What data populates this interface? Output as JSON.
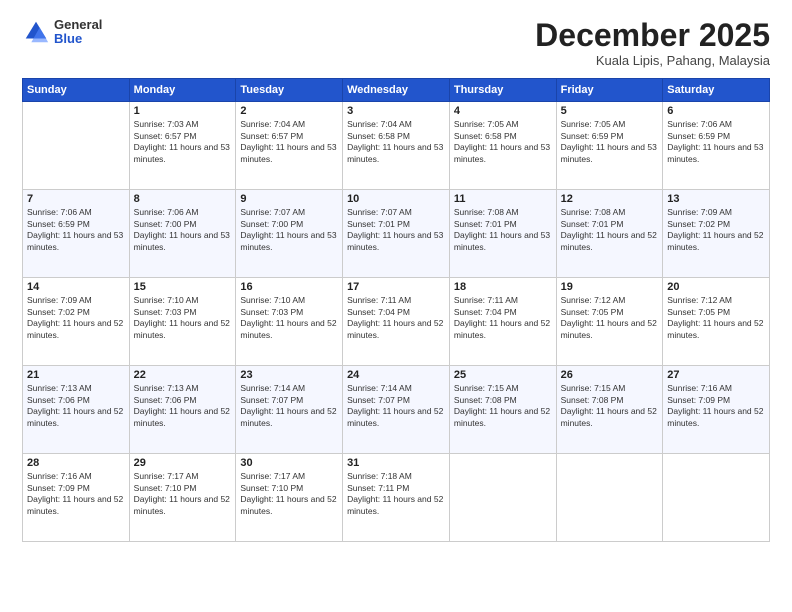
{
  "logo": {
    "general": "General",
    "blue": "Blue"
  },
  "header": {
    "month": "December 2025",
    "location": "Kuala Lipis, Pahang, Malaysia"
  },
  "days_of_week": [
    "Sunday",
    "Monday",
    "Tuesday",
    "Wednesday",
    "Thursday",
    "Friday",
    "Saturday"
  ],
  "weeks": [
    [
      {
        "day": "",
        "sunrise": "",
        "sunset": "",
        "daylight": ""
      },
      {
        "day": "1",
        "sunrise": "Sunrise: 7:03 AM",
        "sunset": "Sunset: 6:57 PM",
        "daylight": "Daylight: 11 hours and 53 minutes."
      },
      {
        "day": "2",
        "sunrise": "Sunrise: 7:04 AM",
        "sunset": "Sunset: 6:57 PM",
        "daylight": "Daylight: 11 hours and 53 minutes."
      },
      {
        "day": "3",
        "sunrise": "Sunrise: 7:04 AM",
        "sunset": "Sunset: 6:58 PM",
        "daylight": "Daylight: 11 hours and 53 minutes."
      },
      {
        "day": "4",
        "sunrise": "Sunrise: 7:05 AM",
        "sunset": "Sunset: 6:58 PM",
        "daylight": "Daylight: 11 hours and 53 minutes."
      },
      {
        "day": "5",
        "sunrise": "Sunrise: 7:05 AM",
        "sunset": "Sunset: 6:59 PM",
        "daylight": "Daylight: 11 hours and 53 minutes."
      },
      {
        "day": "6",
        "sunrise": "Sunrise: 7:06 AM",
        "sunset": "Sunset: 6:59 PM",
        "daylight": "Daylight: 11 hours and 53 minutes."
      }
    ],
    [
      {
        "day": "7",
        "sunrise": "Sunrise: 7:06 AM",
        "sunset": "Sunset: 6:59 PM",
        "daylight": "Daylight: 11 hours and 53 minutes."
      },
      {
        "day": "8",
        "sunrise": "Sunrise: 7:06 AM",
        "sunset": "Sunset: 7:00 PM",
        "daylight": "Daylight: 11 hours and 53 minutes."
      },
      {
        "day": "9",
        "sunrise": "Sunrise: 7:07 AM",
        "sunset": "Sunset: 7:00 PM",
        "daylight": "Daylight: 11 hours and 53 minutes."
      },
      {
        "day": "10",
        "sunrise": "Sunrise: 7:07 AM",
        "sunset": "Sunset: 7:01 PM",
        "daylight": "Daylight: 11 hours and 53 minutes."
      },
      {
        "day": "11",
        "sunrise": "Sunrise: 7:08 AM",
        "sunset": "Sunset: 7:01 PM",
        "daylight": "Daylight: 11 hours and 53 minutes."
      },
      {
        "day": "12",
        "sunrise": "Sunrise: 7:08 AM",
        "sunset": "Sunset: 7:01 PM",
        "daylight": "Daylight: 11 hours and 52 minutes."
      },
      {
        "day": "13",
        "sunrise": "Sunrise: 7:09 AM",
        "sunset": "Sunset: 7:02 PM",
        "daylight": "Daylight: 11 hours and 52 minutes."
      }
    ],
    [
      {
        "day": "14",
        "sunrise": "Sunrise: 7:09 AM",
        "sunset": "Sunset: 7:02 PM",
        "daylight": "Daylight: 11 hours and 52 minutes."
      },
      {
        "day": "15",
        "sunrise": "Sunrise: 7:10 AM",
        "sunset": "Sunset: 7:03 PM",
        "daylight": "Daylight: 11 hours and 52 minutes."
      },
      {
        "day": "16",
        "sunrise": "Sunrise: 7:10 AM",
        "sunset": "Sunset: 7:03 PM",
        "daylight": "Daylight: 11 hours and 52 minutes."
      },
      {
        "day": "17",
        "sunrise": "Sunrise: 7:11 AM",
        "sunset": "Sunset: 7:04 PM",
        "daylight": "Daylight: 11 hours and 52 minutes."
      },
      {
        "day": "18",
        "sunrise": "Sunrise: 7:11 AM",
        "sunset": "Sunset: 7:04 PM",
        "daylight": "Daylight: 11 hours and 52 minutes."
      },
      {
        "day": "19",
        "sunrise": "Sunrise: 7:12 AM",
        "sunset": "Sunset: 7:05 PM",
        "daylight": "Daylight: 11 hours and 52 minutes."
      },
      {
        "day": "20",
        "sunrise": "Sunrise: 7:12 AM",
        "sunset": "Sunset: 7:05 PM",
        "daylight": "Daylight: 11 hours and 52 minutes."
      }
    ],
    [
      {
        "day": "21",
        "sunrise": "Sunrise: 7:13 AM",
        "sunset": "Sunset: 7:06 PM",
        "daylight": "Daylight: 11 hours and 52 minutes."
      },
      {
        "day": "22",
        "sunrise": "Sunrise: 7:13 AM",
        "sunset": "Sunset: 7:06 PM",
        "daylight": "Daylight: 11 hours and 52 minutes."
      },
      {
        "day": "23",
        "sunrise": "Sunrise: 7:14 AM",
        "sunset": "Sunset: 7:07 PM",
        "daylight": "Daylight: 11 hours and 52 minutes."
      },
      {
        "day": "24",
        "sunrise": "Sunrise: 7:14 AM",
        "sunset": "Sunset: 7:07 PM",
        "daylight": "Daylight: 11 hours and 52 minutes."
      },
      {
        "day": "25",
        "sunrise": "Sunrise: 7:15 AM",
        "sunset": "Sunset: 7:08 PM",
        "daylight": "Daylight: 11 hours and 52 minutes."
      },
      {
        "day": "26",
        "sunrise": "Sunrise: 7:15 AM",
        "sunset": "Sunset: 7:08 PM",
        "daylight": "Daylight: 11 hours and 52 minutes."
      },
      {
        "day": "27",
        "sunrise": "Sunrise: 7:16 AM",
        "sunset": "Sunset: 7:09 PM",
        "daylight": "Daylight: 11 hours and 52 minutes."
      }
    ],
    [
      {
        "day": "28",
        "sunrise": "Sunrise: 7:16 AM",
        "sunset": "Sunset: 7:09 PM",
        "daylight": "Daylight: 11 hours and 52 minutes."
      },
      {
        "day": "29",
        "sunrise": "Sunrise: 7:17 AM",
        "sunset": "Sunset: 7:10 PM",
        "daylight": "Daylight: 11 hours and 52 minutes."
      },
      {
        "day": "30",
        "sunrise": "Sunrise: 7:17 AM",
        "sunset": "Sunset: 7:10 PM",
        "daylight": "Daylight: 11 hours and 52 minutes."
      },
      {
        "day": "31",
        "sunrise": "Sunrise: 7:18 AM",
        "sunset": "Sunset: 7:11 PM",
        "daylight": "Daylight: 11 hours and 52 minutes."
      },
      {
        "day": "",
        "sunrise": "",
        "sunset": "",
        "daylight": ""
      },
      {
        "day": "",
        "sunrise": "",
        "sunset": "",
        "daylight": ""
      },
      {
        "day": "",
        "sunrise": "",
        "sunset": "",
        "daylight": ""
      }
    ]
  ]
}
